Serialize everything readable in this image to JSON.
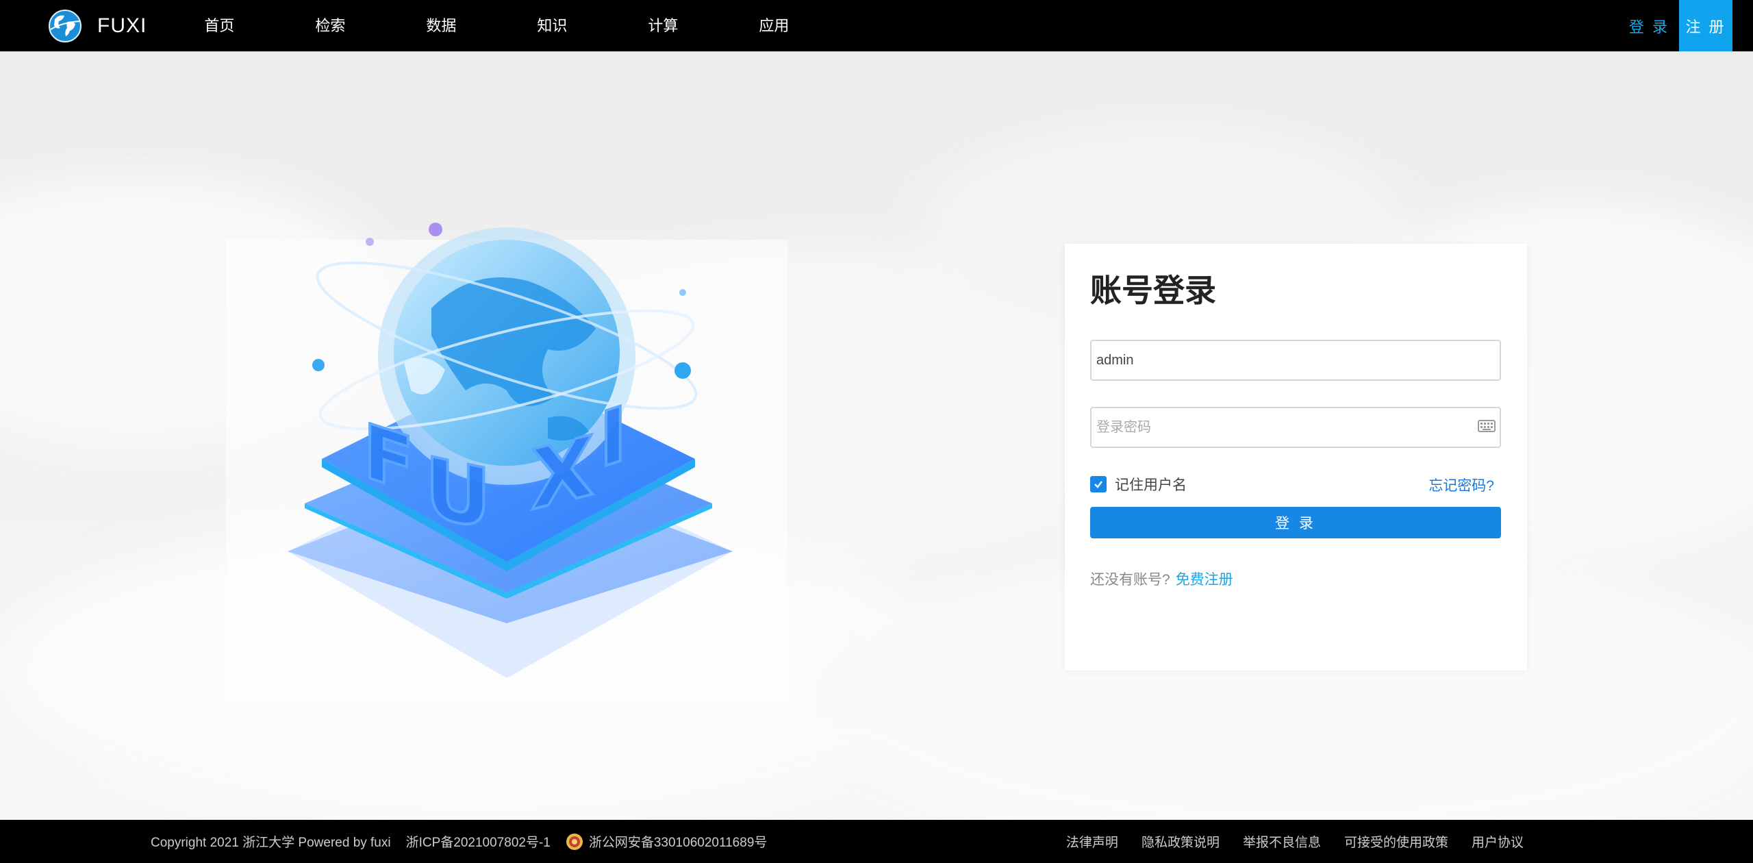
{
  "brand": {
    "name": "FUXI"
  },
  "nav": {
    "items": [
      {
        "label": "首页"
      },
      {
        "label": "检索"
      },
      {
        "label": "数据"
      },
      {
        "label": "知识"
      },
      {
        "label": "计算"
      },
      {
        "label": "应用"
      }
    ]
  },
  "auth": {
    "login_label": "登 录",
    "register_label": "注 册"
  },
  "login_card": {
    "title": "账号登录",
    "username_value": "admin",
    "password_placeholder": "登录密码",
    "remember_label": "记住用户名",
    "remember_checked": true,
    "forgot_label": "忘记密码?",
    "submit_label": "登 录",
    "no_account_text": "还没有账号?",
    "register_link": "免费注册"
  },
  "footer": {
    "copyright": "Copyright 2021 浙江大学 Powered by fuxi",
    "icp": "浙ICP备2021007802号-1",
    "police": "浙公网安备33010602011689号",
    "links": [
      {
        "label": "法律声明"
      },
      {
        "label": "隐私政策说明"
      },
      {
        "label": "举报不良信息"
      },
      {
        "label": "可接受的使用政策"
      },
      {
        "label": "用户协议"
      }
    ]
  },
  "colors": {
    "primary": "#1787e6",
    "accent": "#1ba6e8",
    "topbar": "#000000",
    "footer": "#000000"
  },
  "icons": [
    "globe-logo-icon",
    "keyboard-icon",
    "check-icon",
    "police-badge-icon"
  ]
}
